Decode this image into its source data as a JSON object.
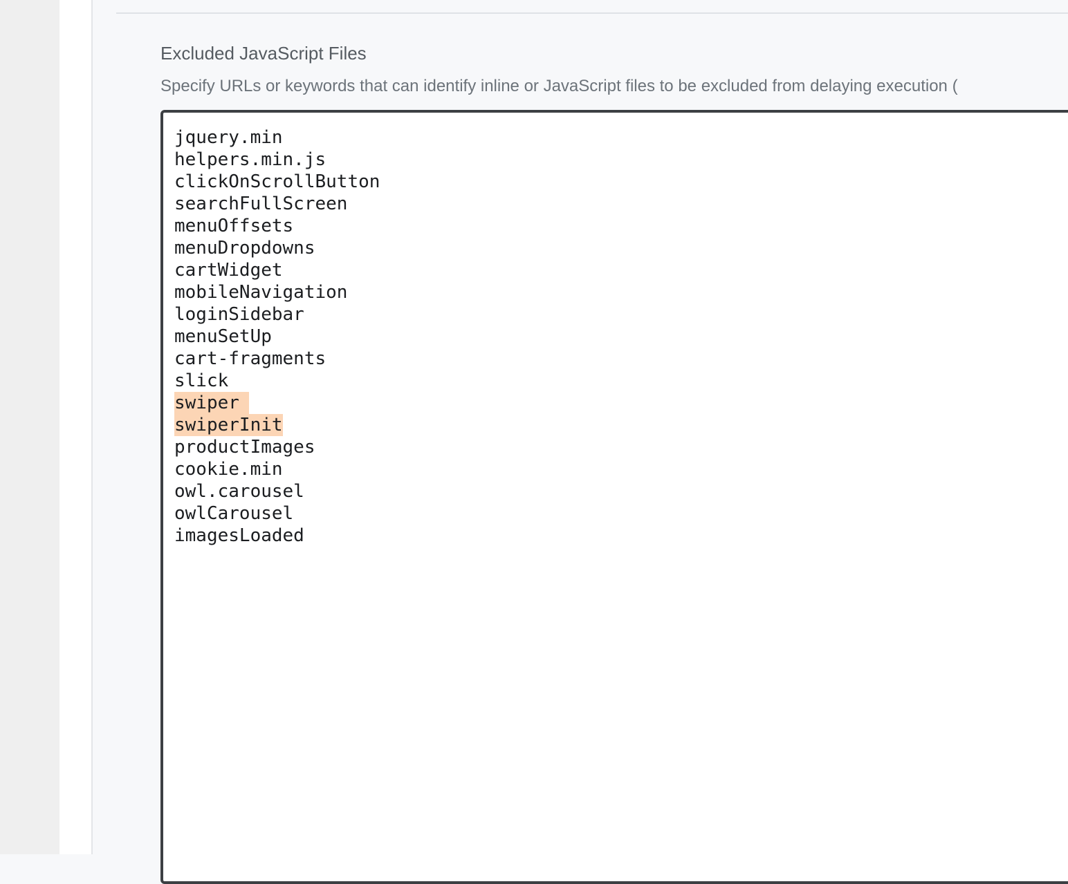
{
  "settings_field": {
    "title": "Excluded JavaScript Files",
    "description": "Specify URLs or keywords that can identify inline or JavaScript files to be excluded from delaying execution (",
    "lines": [
      "jquery.min",
      "helpers.min.js",
      "clickOnScrollButton",
      "searchFullScreen",
      "menuOffsets",
      "menuDropdowns",
      "cartWidget",
      "mobileNavigation",
      "loginSidebar",
      "menuSetUp",
      "cart-fragments",
      "slick",
      "swiper",
      "swiperInit",
      "productImages",
      "cookie.min",
      "owl.carousel",
      "owlCarousel",
      "imagesLoaded"
    ],
    "highlight_color": "#fcd5b5"
  }
}
